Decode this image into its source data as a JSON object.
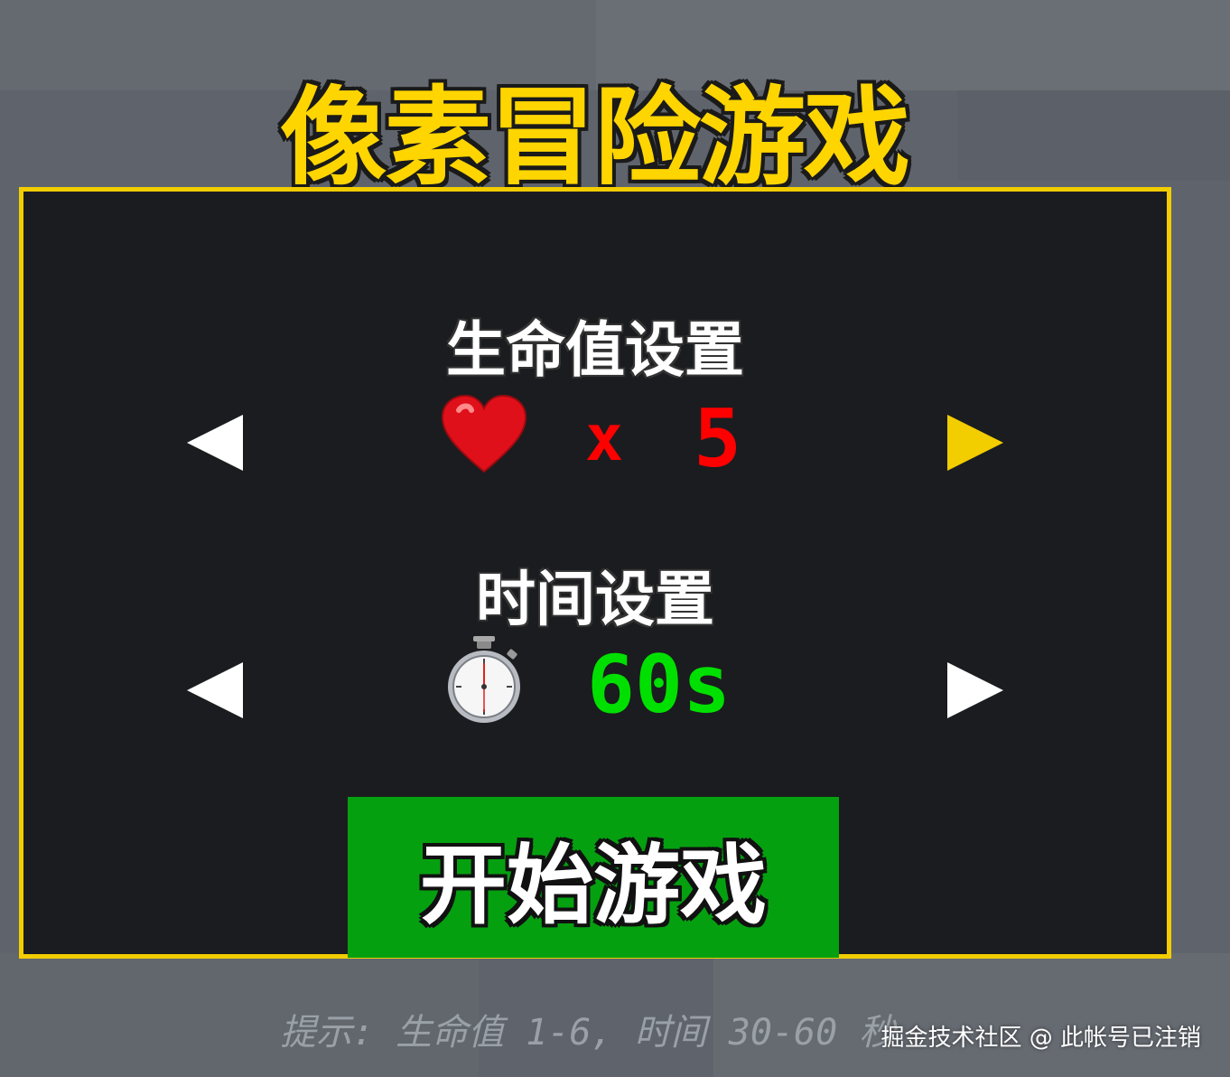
{
  "game": {
    "title": "像素冒险游戏",
    "hint": "提示: 生命值 1-6, 时间 30-60 秒",
    "watermark": "掘金技术社区 @ 此帐号已注销"
  },
  "health_setting": {
    "label": "生命值设置",
    "icon": "heart-icon",
    "multiplier_label": "x",
    "value": "5",
    "value_color": "#ff0000"
  },
  "time_setting": {
    "label": "时间设置",
    "icon": "stopwatch-icon",
    "value": "60s",
    "value_color": "#00e000"
  },
  "start_button": {
    "label": "开始游戏"
  },
  "colors": {
    "accent": "#f2cd00",
    "panel_bg": "#1b1c1f",
    "button_bg": "#05a010",
    "active_arrow": "#f2cd00"
  }
}
